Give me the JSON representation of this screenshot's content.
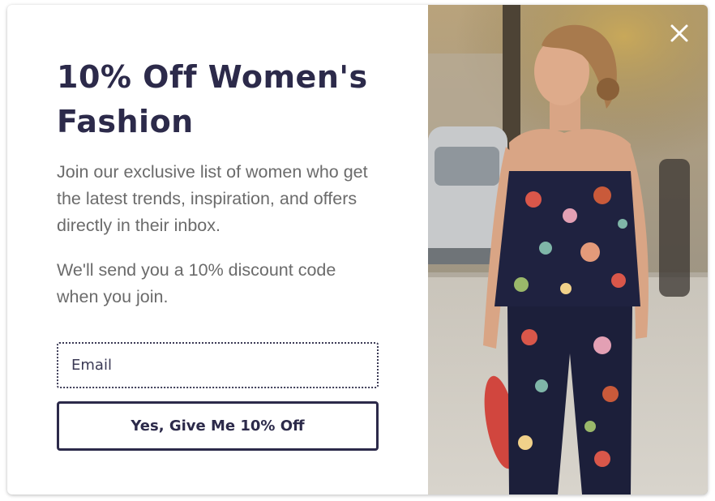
{
  "popup": {
    "headline": "10% Off Women's Fashion",
    "paragraph_1": "Join our exclusive list of women who get the latest trends, inspiration, and offers directly in their inbox.",
    "paragraph_2": "We'll send you a 10% discount code when you join.",
    "email_field": {
      "placeholder": "Email",
      "value": ""
    },
    "submit_label": "Yes, Give Me 10% Off"
  },
  "image": {
    "icon": "close-icon"
  },
  "colors": {
    "headline": "#2c2a4a",
    "body_text": "#6b6b6b",
    "button_border": "#2c2a4a",
    "close_icon": "#ffffff"
  }
}
